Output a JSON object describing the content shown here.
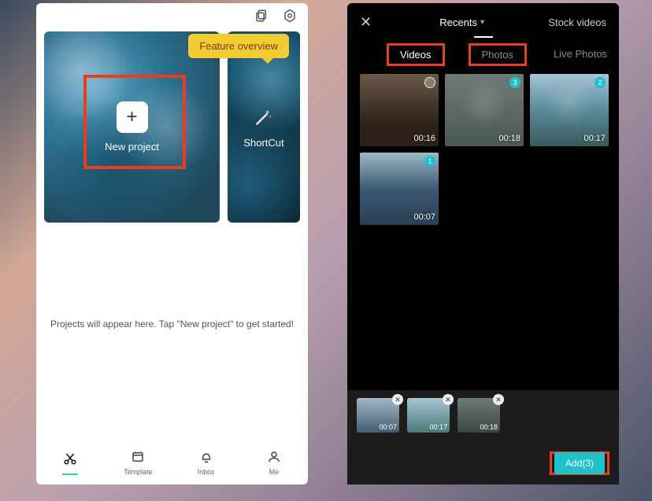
{
  "left": {
    "feature_badge": "Feature overview",
    "new_project_label": "New project",
    "shortcut_label": "ShortCut",
    "empty_hint": "Projects will appear here. Tap \"New project\" to get started!",
    "tabs": {
      "edit": "",
      "template": "Template",
      "inbox": "Inbox",
      "me": "Me"
    }
  },
  "right": {
    "header": {
      "title": "Recents",
      "stock": "Stock videos"
    },
    "type_tabs": {
      "videos": "Videos",
      "photos": "Photos",
      "live": "Live Photos"
    },
    "grid": [
      {
        "duration": "00:16",
        "selected": false
      },
      {
        "duration": "00:18",
        "selected": true,
        "order": "3"
      },
      {
        "duration": "00:17",
        "selected": true,
        "order": "2"
      },
      {
        "duration": "00:07",
        "selected": true,
        "order": "1"
      }
    ],
    "tray": [
      {
        "duration": "00:07"
      },
      {
        "duration": "00:17"
      },
      {
        "duration": "00:18"
      }
    ],
    "add_label": "Add(3)"
  }
}
